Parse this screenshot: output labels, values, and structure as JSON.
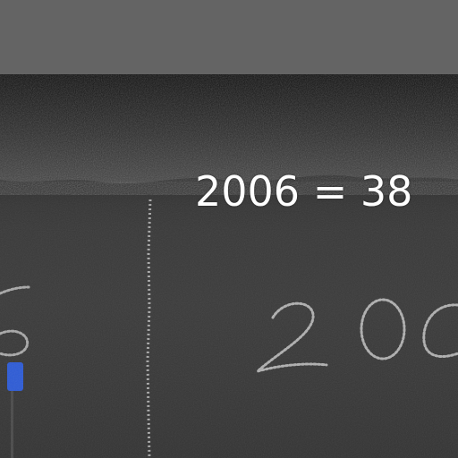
{
  "overlay": {
    "label": "2006 = 38"
  },
  "photo": {
    "description_tag": "chalk-marked-cave-wall",
    "chalk_writing": "200",
    "palette": {
      "bar": "#646464",
      "rock_dark": "#151515",
      "wall": "#383838",
      "chalk": "#bfbfbf",
      "marker_blue": "#2d5bd6"
    }
  }
}
